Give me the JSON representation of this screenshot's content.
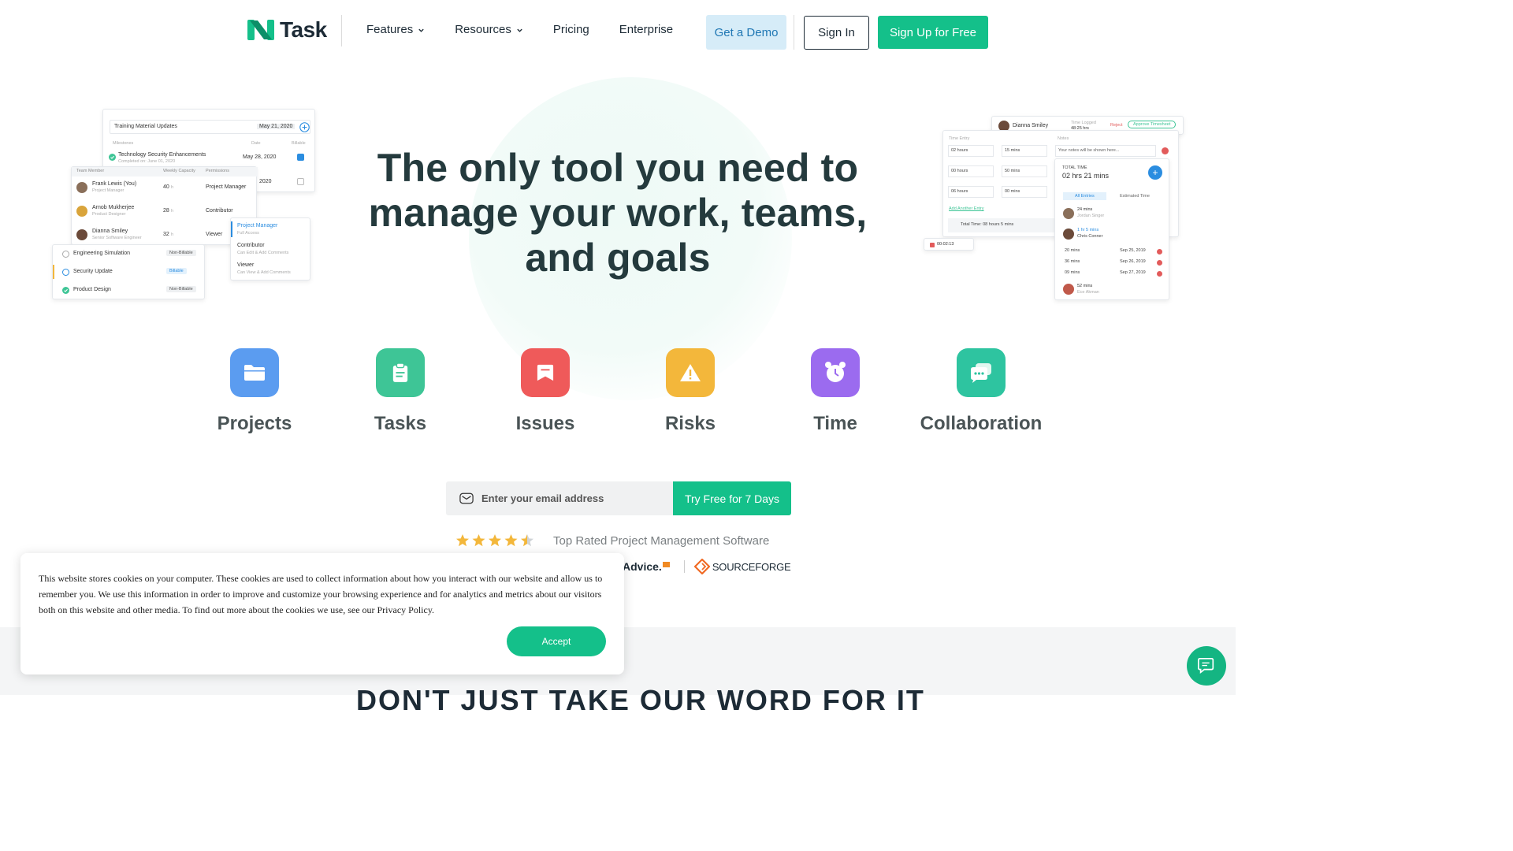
{
  "header": {
    "logo_text": "Task",
    "nav": [
      {
        "label": "Features",
        "has_dropdown": true
      },
      {
        "label": "Resources",
        "has_dropdown": true
      },
      {
        "label": "Pricing",
        "has_dropdown": false
      },
      {
        "label": "Enterprise",
        "has_dropdown": false
      }
    ],
    "demo_label": "Get a Demo",
    "signin_label": "Sign In",
    "signup_label": "Sign Up for Free"
  },
  "hero": {
    "title": "The only tool you need to manage your work, teams, and goals"
  },
  "left_mock": {
    "task_title": "Training Material Updates",
    "task_date": "May 21, 2020",
    "col_milestones": "Milestones",
    "col_date": "Date",
    "col_billable": "Billable",
    "milestone_name": "Technology Security Enhancements",
    "milestone_sub": "Completed on: June 01, 2020",
    "milestone_date": "May 28, 2020",
    "second_date": "2020",
    "team_cols": [
      "Team Member",
      "Weekly Capacity",
      "Permissions"
    ],
    "members": [
      {
        "name": "Frank Lewis (You)",
        "role": "Project Manager",
        "capacity": "40",
        "unit": "h",
        "permission": "Project Manager"
      },
      {
        "name": "Arnob Mukherjee",
        "role": "Product Designer",
        "capacity": "28",
        "unit": "h",
        "permission": "Contributor"
      },
      {
        "name": "Dianna Smiley",
        "role": "Senior Software Engineer",
        "capacity": "32",
        "unit": "h",
        "permission": "Viewer"
      }
    ],
    "permission_options": [
      {
        "title": "Project Manager",
        "sub": "Full Access"
      },
      {
        "title": "Contributor",
        "sub": "Can Edit & Add Comments"
      },
      {
        "title": "Viewer",
        "sub": "Can View & Add Comments"
      }
    ],
    "projects": [
      {
        "name": "Engineering Simulation",
        "tag": "Non-Billable"
      },
      {
        "name": "Security Update",
        "tag": "Billable"
      },
      {
        "name": "Product Design",
        "tag": "Non-Billable"
      }
    ]
  },
  "right_mock": {
    "user_name": "Dianna Smiley",
    "time_logged_label": "Time Logged",
    "time_logged_value": "48:25 hrs",
    "reject_label": "Reject",
    "approve_label": "Approve Timesheet",
    "time_entry_label": "Time Entry",
    "notes_label": "Notes",
    "notes_placeholder": "Your notes will be shown here...",
    "entries": [
      {
        "hours": "02 hours",
        "mins": "15 mins"
      },
      {
        "hours": "00 hours",
        "mins": "50 mins"
      },
      {
        "hours": "06 hours",
        "mins": "00 mins"
      }
    ],
    "add_entry_label": "Add Another Entry",
    "total_time_label": "Total Time: 08 hours 5 mins",
    "timer_value": "00:02:13",
    "total_label": "TOTAL TIME",
    "total_value": "02 hrs 21 mins",
    "tab_all": "All Entries",
    "tab_estimated": "Estimated Time",
    "log_users": [
      {
        "time": "24 mins",
        "name": "Jordan Singer"
      },
      {
        "time": "1 hr 5 mins",
        "name": "Chris Conner"
      }
    ],
    "log_rows": [
      {
        "time": "20 mins",
        "date": "Sep 25, 2019"
      },
      {
        "time": "36 mins",
        "date": "Sep 26, 2019"
      },
      {
        "time": "09 mins",
        "date": "Sep 27, 2019"
      }
    ],
    "last_user": {
      "time": "52 mins",
      "name": "Ece Akman"
    }
  },
  "features": [
    {
      "label": "Projects",
      "icon": "folder-icon",
      "color": "#5b9cf0"
    },
    {
      "label": "Tasks",
      "icon": "clipboard-icon",
      "color": "#3ec596"
    },
    {
      "label": "Issues",
      "icon": "issue-icon",
      "color": "#ef5a5a"
    },
    {
      "label": "Risks",
      "icon": "warning-icon",
      "color": "#f3b73b"
    },
    {
      "label": "Time",
      "icon": "alarm-clock-icon",
      "color": "#9b6bef"
    },
    {
      "label": "Collaboration",
      "icon": "chat-icon",
      "color": "#2ec4a0"
    }
  ],
  "signup": {
    "email_placeholder": "Enter your email address",
    "button_label": "Try Free for 7 Days"
  },
  "rating": {
    "stars": 4.5,
    "text": "Top Rated Project Management Software"
  },
  "review_logos": [
    {
      "name": "Advice",
      "text": "Advice."
    },
    {
      "name": "sourceforge",
      "text": "SOURCEFORGE"
    }
  ],
  "bottom_heading": "DON'T JUST TAKE OUR WORD FOR IT",
  "cookie": {
    "text": "This website stores cookies on your computer. These cookies are used to collect information about how you interact with our website and allow us to remember you. We use this information in order to improve and customize your browsing experience and for analytics and metrics about our visitors both on this website and other media. To find out more about the cookies we use, see our Privacy Policy.",
    "accept_label": "Accept"
  },
  "colors": {
    "brand_green": "#14c08a",
    "demo_bg": "#d6ecf8",
    "demo_text": "#1f77b4"
  }
}
